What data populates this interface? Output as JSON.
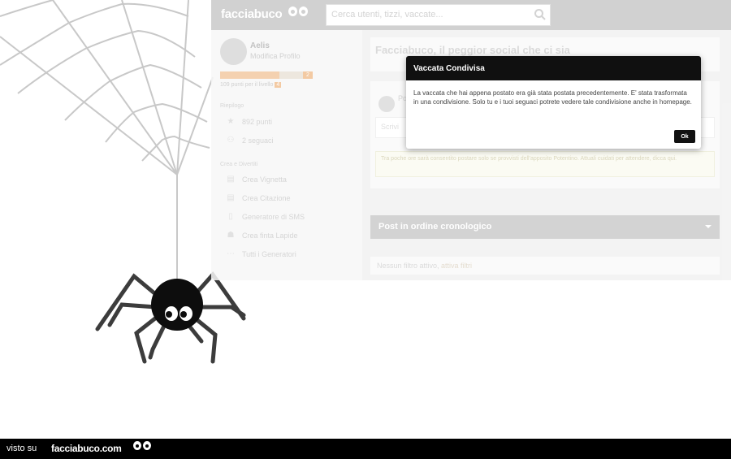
{
  "header": {
    "logo": "facciabuco",
    "search_placeholder": "Cerca utenti, tizzi, vaccate..."
  },
  "sidebar": {
    "user_name": "Aelis",
    "edit_profile": "Modifica Profilo",
    "level": "2",
    "progress": 0.7,
    "points_next": "109 punti per il livello",
    "points_next_level": "4",
    "section_overview": "Riepilogo",
    "stats": [
      {
        "icon": "star-icon",
        "label": "892 punti"
      },
      {
        "icon": "followers-icon",
        "label": "2 seguaci"
      }
    ],
    "section_tools": "Crea e Divertiti",
    "tools": [
      {
        "icon": "vignette-icon",
        "label": "Crea Vignetta"
      },
      {
        "icon": "quote-icon",
        "label": "Crea Citazione"
      },
      {
        "icon": "phone-icon",
        "label": "Generatore di SMS"
      },
      {
        "icon": "tombstone-icon",
        "label": "Crea finta Lapide"
      },
      {
        "icon": "more-icon",
        "label": "Tutti i Generatori"
      }
    ]
  },
  "main": {
    "headline": "Facciabuco, il peggior social che ci sia",
    "post_author_short": "Po",
    "post_input_placeholder": "Scrivi",
    "post_note": "Tra poche ore sarà consentito postare solo se provvisti dell'apposito Potentino. Attuali cuidati per attendere, dicca qui.",
    "chrono_bar": "Post in ordine cronologico",
    "no_filter_text": "Nessun filtro attivo,",
    "no_filter_link": "attiva filtri"
  },
  "modal": {
    "title": "Vaccata Condivisa",
    "body": "La vaccata che hai appena postato era già stata postata precedentemente. E' stata trasformata in una condivisione. Solo tu e i tuoi seguaci potrete vedere tale condivisione anche in homepage.",
    "ok": "Ok"
  },
  "footer": {
    "seen_on": "visto su",
    "site": "facciabuco.com"
  },
  "colors": {
    "accent": "#c9c9c9",
    "modal_head": "#101010",
    "footer": "#000000"
  }
}
